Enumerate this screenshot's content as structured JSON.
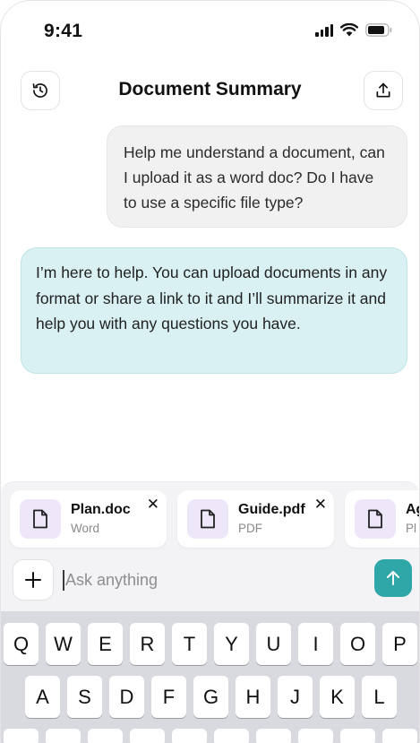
{
  "status_bar": {
    "time": "9:41",
    "icons": [
      "cellular-signal-icon",
      "wifi-icon",
      "battery-icon"
    ]
  },
  "header": {
    "title": "Document Summary",
    "left_icon": "history-icon",
    "right_icon": "share-upload-icon"
  },
  "messages": [
    {
      "role": "user",
      "text": "Help me understand a document, can I upload it as a word doc? Do I have to use a specific file type?"
    },
    {
      "role": "assistant",
      "text": "I’m here to help. You can upload documents in any format or share a link to it and I’ll summarize it and help you with any questions you have."
    }
  ],
  "attachments": [
    {
      "name": "Plan.doc",
      "type": "Word"
    },
    {
      "name": "Guide.pdf",
      "type": "PDF"
    },
    {
      "name": "Ag",
      "type": "Pl"
    }
  ],
  "composer": {
    "placeholder": "Ask anything",
    "add_label": "+",
    "remove_label": "✕"
  },
  "keyboard": {
    "row1": [
      "Q",
      "W",
      "E",
      "R",
      "T",
      "Y",
      "U",
      "I",
      "O",
      "P"
    ],
    "row2": [
      "A",
      "S",
      "D",
      "F",
      "G",
      "H",
      "J",
      "K",
      "L"
    ],
    "row3": [
      "",
      "",
      "",
      "",
      "",
      "",
      "",
      "",
      "",
      ""
    ]
  },
  "colors": {
    "accent": "#2fa7a9",
    "assistant_bubble": "#d9f1f3",
    "user_bubble": "#f1f1f2",
    "file_thumb": "#eee6f9"
  }
}
